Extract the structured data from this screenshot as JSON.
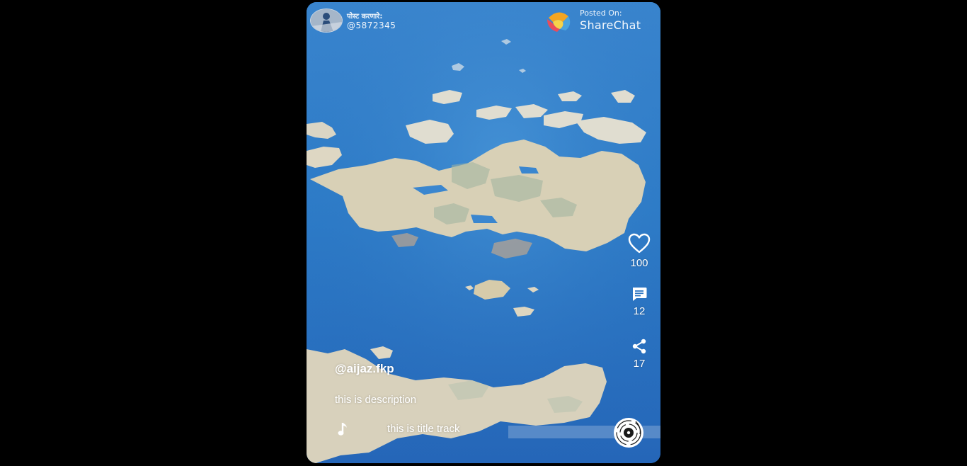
{
  "watermark": {
    "poster_label": "पोस्ट करणारे:",
    "poster_handle": "@5872345",
    "posted_on": "Posted On:",
    "brand": "ShareChat"
  },
  "actions": {
    "likes": "100",
    "comments": "12",
    "shares": "17"
  },
  "caption": {
    "username": "@aijaz.fkp",
    "description": "this is description",
    "track_title": "this is title track"
  },
  "icons": {
    "like": "heart-icon",
    "comment": "comment-icon",
    "share": "share-icon",
    "music": "music-note-icon",
    "disc": "vinyl-disc-icon"
  },
  "colors": {
    "page_background": "#000000",
    "ocean": "#2a78c8",
    "land": "#d9d0b8",
    "text": "#ffffff"
  }
}
